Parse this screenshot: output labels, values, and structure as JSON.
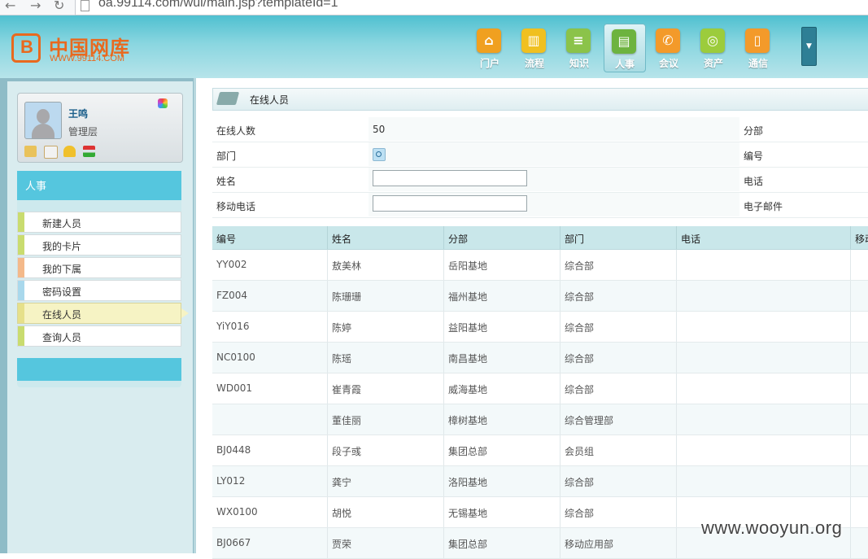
{
  "browser": {
    "url": "oa.99114.com/wui/main.jsp?templateId=1"
  },
  "logo": {
    "name_cn": "中国网库",
    "name_en": "WWW.99114.COM"
  },
  "top_nav": [
    {
      "label": "门户",
      "icon": "home-icon",
      "color": "#f0a020",
      "glyph": "⌂"
    },
    {
      "label": "流程",
      "icon": "chart-icon",
      "color": "#f0c020",
      "glyph": "▥"
    },
    {
      "label": "知识",
      "icon": "database-icon",
      "color": "#8bc34a",
      "glyph": "≡"
    },
    {
      "label": "人事",
      "icon": "card-icon",
      "color": "#6db33f",
      "glyph": "▤",
      "active": true
    },
    {
      "label": "会议",
      "icon": "phone-icon",
      "color": "#f39a2a",
      "glyph": "✆"
    },
    {
      "label": "资产",
      "icon": "coins-icon",
      "color": "#9ccc3c",
      "glyph": "◎"
    },
    {
      "label": "通信",
      "icon": "mobile-icon",
      "color": "#f39a2a",
      "glyph": "▯"
    }
  ],
  "user": {
    "name": "王鸣",
    "role": "管理层"
  },
  "sidebar": {
    "section_title": "人事",
    "items": [
      {
        "label": "新建人员",
        "bar_color": "#c9dc6f"
      },
      {
        "label": "我的卡片",
        "bar_color": "#c9dc6f"
      },
      {
        "label": "我的下属",
        "bar_color": "#f4b98a"
      },
      {
        "label": "密码设置",
        "bar_color": "#a9d8ec"
      },
      {
        "label": "在线人员",
        "bar_color": "#e6e08a",
        "active": true
      },
      {
        "label": "查询人员",
        "bar_color": "#c9dc6f"
      }
    ]
  },
  "panel": {
    "title": "在线人员"
  },
  "form": {
    "online_count_label": "在线人数",
    "online_count_value": "50",
    "branch_label": "分部",
    "dept_label": "部门",
    "code_label": "编号",
    "name_label": "姓名",
    "name_value": "",
    "phone_label": "电话",
    "mobile_label": "移动电话",
    "mobile_value": "",
    "email_label": "电子邮件"
  },
  "table": {
    "columns": [
      "编号",
      "姓名",
      "分部",
      "部门",
      "电话",
      "移动"
    ],
    "rows": [
      [
        "YY002",
        "敖美林",
        "岳阳基地",
        "综合部",
        "",
        ""
      ],
      [
        "FZ004",
        "陈珊珊",
        "福州基地",
        "综合部",
        "",
        ""
      ],
      [
        "YiY016",
        "陈婷",
        "益阳基地",
        "综合部",
        "",
        ""
      ],
      [
        "NC0100",
        "陈瑶",
        "南昌基地",
        "综合部",
        "",
        ""
      ],
      [
        "WD001",
        "崔青霞",
        "威海基地",
        "综合部",
        "",
        ""
      ],
      [
        "",
        "董佳丽",
        "樟树基地",
        "综合管理部",
        "",
        ""
      ],
      [
        "BJ0448",
        "段子彧",
        "集团总部",
        "会员组",
        "",
        ""
      ],
      [
        "LY012",
        "龚宁",
        "洛阳基地",
        "综合部",
        "",
        ""
      ],
      [
        "WX0100",
        "胡悦",
        "无锡基地",
        "综合部",
        "",
        ""
      ],
      [
        "BJ0667",
        "贾荣",
        "集团总部",
        "移动应用部",
        "",
        ""
      ]
    ]
  },
  "watermark": "www.wooyun.org"
}
